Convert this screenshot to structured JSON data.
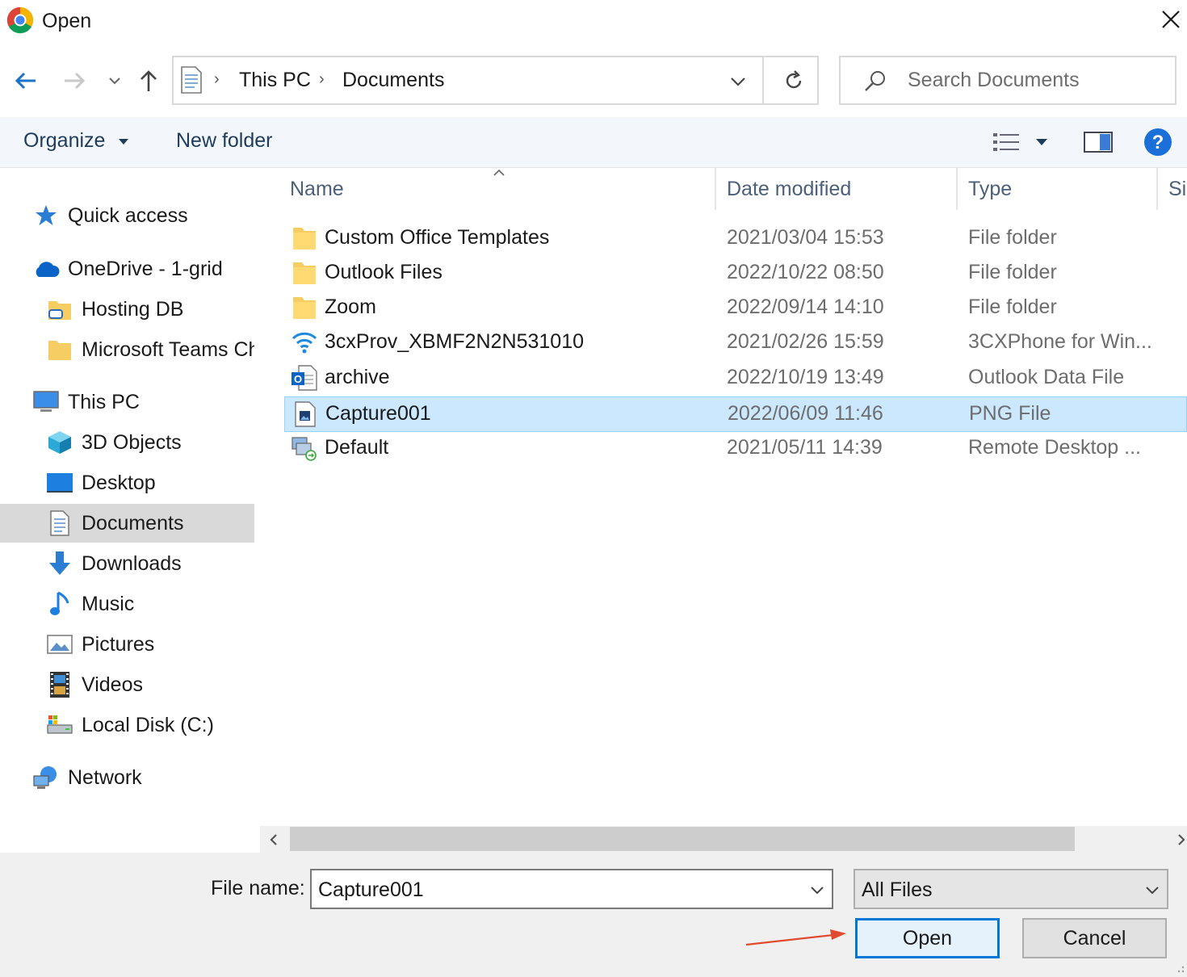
{
  "window": {
    "title": "Open"
  },
  "address": {
    "crumbs": [
      "This PC",
      "Documents"
    ],
    "search_placeholder": "Search Documents"
  },
  "toolbar": {
    "organize_label": "Organize",
    "new_folder_label": "New folder"
  },
  "sidebar": {
    "items": [
      {
        "label": "Quick access",
        "icon": "star-icon"
      },
      {
        "label": "OneDrive - 1-grid",
        "icon": "cloud-icon"
      },
      {
        "label": "Hosting DB",
        "icon": "shared-folder-icon"
      },
      {
        "label": "Microsoft Teams Chat Files",
        "icon": "folder-icon"
      },
      {
        "label": "This PC",
        "icon": "computer-icon"
      },
      {
        "label": "3D Objects",
        "icon": "cube-icon"
      },
      {
        "label": "Desktop",
        "icon": "desktop-icon"
      },
      {
        "label": "Documents",
        "icon": "documents-icon",
        "selected": true
      },
      {
        "label": "Downloads",
        "icon": "download-arrow-icon"
      },
      {
        "label": "Music",
        "icon": "music-note-icon"
      },
      {
        "label": "Pictures",
        "icon": "pictures-icon"
      },
      {
        "label": "Videos",
        "icon": "film-icon"
      },
      {
        "label": "Local Disk (C:)",
        "icon": "drive-icon"
      },
      {
        "label": "Network",
        "icon": "network-icon"
      }
    ]
  },
  "columns": [
    "Name",
    "Date modified",
    "Type",
    "Size"
  ],
  "files": [
    {
      "name": "Custom Office Templates",
      "date": "2021/03/04 15:53",
      "type": "File folder",
      "icon": "folder-icon"
    },
    {
      "name": "Outlook Files",
      "date": "2022/10/22 08:50",
      "type": "File folder",
      "icon": "folder-icon"
    },
    {
      "name": "Zoom",
      "date": "2022/09/14 14:10",
      "type": "File folder",
      "icon": "folder-icon"
    },
    {
      "name": "3cxProv_XBMF2N2N531010",
      "date": "2021/02/26 15:59",
      "type": "3CXPhone for Win...",
      "icon": "wifi-icon"
    },
    {
      "name": "archive",
      "date": "2022/10/19 13:49",
      "type": "Outlook Data File",
      "icon": "outlook-icon"
    },
    {
      "name": "Capture001",
      "date": "2022/06/09 11:46",
      "type": "PNG File",
      "icon": "image-file-icon",
      "selected": true
    },
    {
      "name": "Default",
      "date": "2021/05/11 14:39",
      "type": "Remote Desktop ...",
      "icon": "remote-desktop-icon"
    }
  ],
  "footer": {
    "file_name_label": "File name:",
    "file_name_value": "Capture001",
    "filter_value": "All Files",
    "open_label": "Open",
    "cancel_label": "Cancel"
  },
  "colors": {
    "selection": "#cce8ff",
    "accent": "#0078d7",
    "annotation_arrow": "#e04a2f"
  }
}
